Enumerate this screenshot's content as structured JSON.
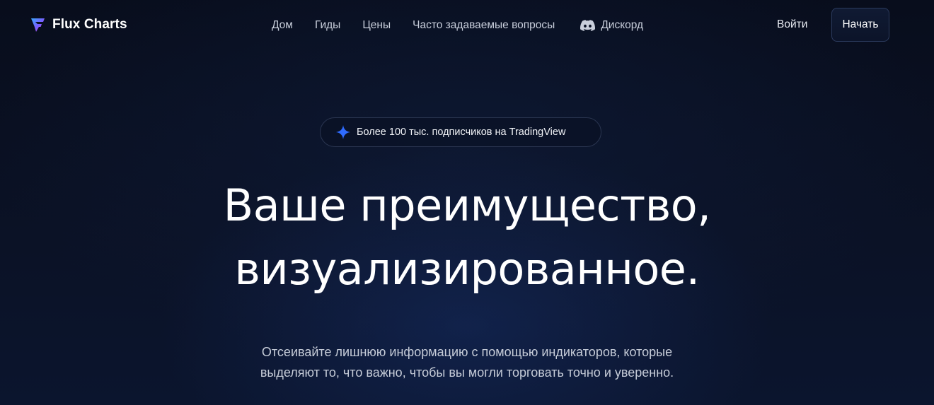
{
  "header": {
    "brand": "Flux Charts",
    "nav": [
      {
        "label": "Дом"
      },
      {
        "label": "Гиды"
      },
      {
        "label": "Цены"
      },
      {
        "label": "Часто задаваемые вопросы"
      },
      {
        "label": "Дискорд",
        "icon": "discord-icon"
      }
    ],
    "login_label": "Войти",
    "start_label": "Начать"
  },
  "hero": {
    "badge": {
      "icon": "sparkle-icon",
      "text": "Более 100 тыс. подписчиков на TradingView"
    },
    "headline_lines": [
      "Ваше преимущество,",
      "визуализированное."
    ],
    "subtitle_lines": [
      "Отсеивайте лишнюю информацию с помощью индикаторов, которые",
      "выделяют то, что важно, чтобы вы могли торговать точно и уверенно."
    ]
  },
  "colors": {
    "background": "#0a1022",
    "accent": "#2f6bff",
    "text_primary": "#ffffff",
    "text_secondary": "#c6ccd8",
    "button_border": "#2c3b5e"
  }
}
